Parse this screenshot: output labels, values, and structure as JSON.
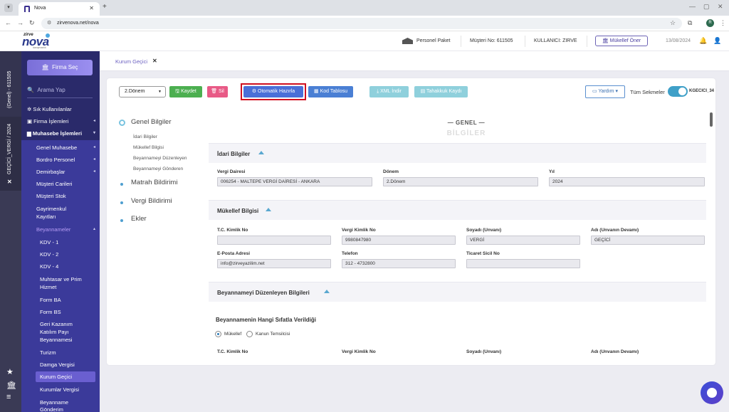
{
  "browser": {
    "tab_title": "Nova",
    "url": "zirvenova.net/nova",
    "profile_initial": "R"
  },
  "header": {
    "logo_brand": "zirve",
    "logo_name": "nova",
    "logo_tagline": "danışmanlık",
    "package": "Personel Paket",
    "customer_no": "Müşteri No: 611505",
    "user": "KULLANICI: ZIRVE",
    "oner_button": "Mükellef Öner",
    "date": "13/08/2024"
  },
  "vstrip": {
    "company_label": "(Genel) - 611505",
    "active_label": "GEÇİCİ_VERGİ / 2024"
  },
  "sidebar": {
    "firma_button": "Firma Seç",
    "search_placeholder": "Arama Yap",
    "items": {
      "frequent": "Sık Kullanılanlar",
      "firma": "Firma İşlemleri",
      "muhasebe": "Muhasebe İşlemleri",
      "genel": "Genel Muhasebe",
      "bordro": "Bordro Personel",
      "demirbas": "Demirbaşlar",
      "cariler": "Müşteri Carileri",
      "stok": "Müşteri Stok",
      "gayrimenkul_1": "Gayrimenkul",
      "gayrimenkul_2": "Kayıtları",
      "beyannameler": "Beyannameler",
      "kdv1": "KDV - 1",
      "kdv2": "KDV - 2",
      "kdv4": "KDV - 4",
      "muhtasar_1": "Muhtasar ve Prim",
      "muhtasar_2": "Hizmet",
      "formba": "Form BA",
      "formbs": "Form BS",
      "gkp_1": "Geri Kazanım",
      "gkp_2": "Katılım Payı",
      "gkp_3": "Beyannamesi",
      "turizm": "Turizm",
      "damga": "Damga Vergisi",
      "kurum_gecici": "Kurum Geçici",
      "kurumlar": "Kurumlar Vergisi",
      "beyanname_gonderim_1": "Beyanname",
      "beyanname_gonderim_2": "Gönderim"
    }
  },
  "breadcrumb": {
    "label": "Kurum Geçici"
  },
  "toolbar": {
    "period": "2.Dönem",
    "save": "Kaydet",
    "delete": "Sil",
    "auto_prepare": "Otomatik Hazırla",
    "code_table": "Kod Tablosu",
    "xml_download": "XML İndir",
    "accrual_record": "Tahakkuk Kaydı",
    "help": "Yardım",
    "all_tabs": "Tüm Sekmeler",
    "tab_code": "KGECICI_34"
  },
  "section_nav": {
    "genel": "Genel Bilgiler",
    "idari": "İdari Bilgiler",
    "mukellef": "Mükellef Bilgisi",
    "duzenleyen": "Beyannameyi Düzenleyen",
    "gonderen": "Beyannameyi Gönderen",
    "matrah": "Matrah Bildirimi",
    "vergi": "Vergi Bildirimi",
    "ekler": "Ekler"
  },
  "form": {
    "title": "GENEL",
    "subtitle": "BİLGİLER",
    "idari_header": "İdari Bilgiler",
    "vergi_dairesi_label": "Vergi Dairesi",
    "vergi_dairesi": "006254 - MALTEPE VERGİ DAİRESİ - ANKARA",
    "donem_label": "Dönem",
    "donem": "2.Dönem",
    "yil_label": "Yıl",
    "yil": "2024",
    "mukellef_header": "Mükellef Bilgisi",
    "tc_label": "T.C. Kimlik No",
    "tc": "",
    "vkn_label": "Vergi Kimlik No",
    "vkn": "9980847980",
    "soyadi_label": "Soyadı (Unvanı)",
    "soyadi": "VERGİ",
    "adi_label": "Adı (Unvanın Devamı)",
    "adi": "GEÇİCİ",
    "eposta_label": "E-Posta Adresi",
    "eposta": "info@zirveyazilim.net",
    "telefon_label": "Telefon",
    "telefon": "312 -  4732800",
    "ticaret_label": "Ticaret Sicil No",
    "ticaret": "",
    "duzenleyen_header": "Beyannameyi Düzenleyen Bilgileri",
    "sifat_title": "Beyannamenin Hangi Sıfatla Verildiği",
    "radio_mukellef": "Mükellef",
    "radio_kanun": "Kanun Temsilcisi",
    "tc2_label": "T.C. Kimlik No",
    "vkn2_label": "Vergi Kimlik No",
    "soyadi2_label": "Soyadı (Unvanı)",
    "adi2_label": "Adı (Unvanın Devamı)"
  },
  "colors": {
    "sidebar_bg": "#2a2a6a",
    "accent": "#6a5fd0",
    "save_green": "#4caf50",
    "delete_pink": "#e85a86",
    "auto_blue": "#4a6fd8",
    "highlight_red": "#d01020",
    "toggle_teal": "#3fa0c8"
  }
}
